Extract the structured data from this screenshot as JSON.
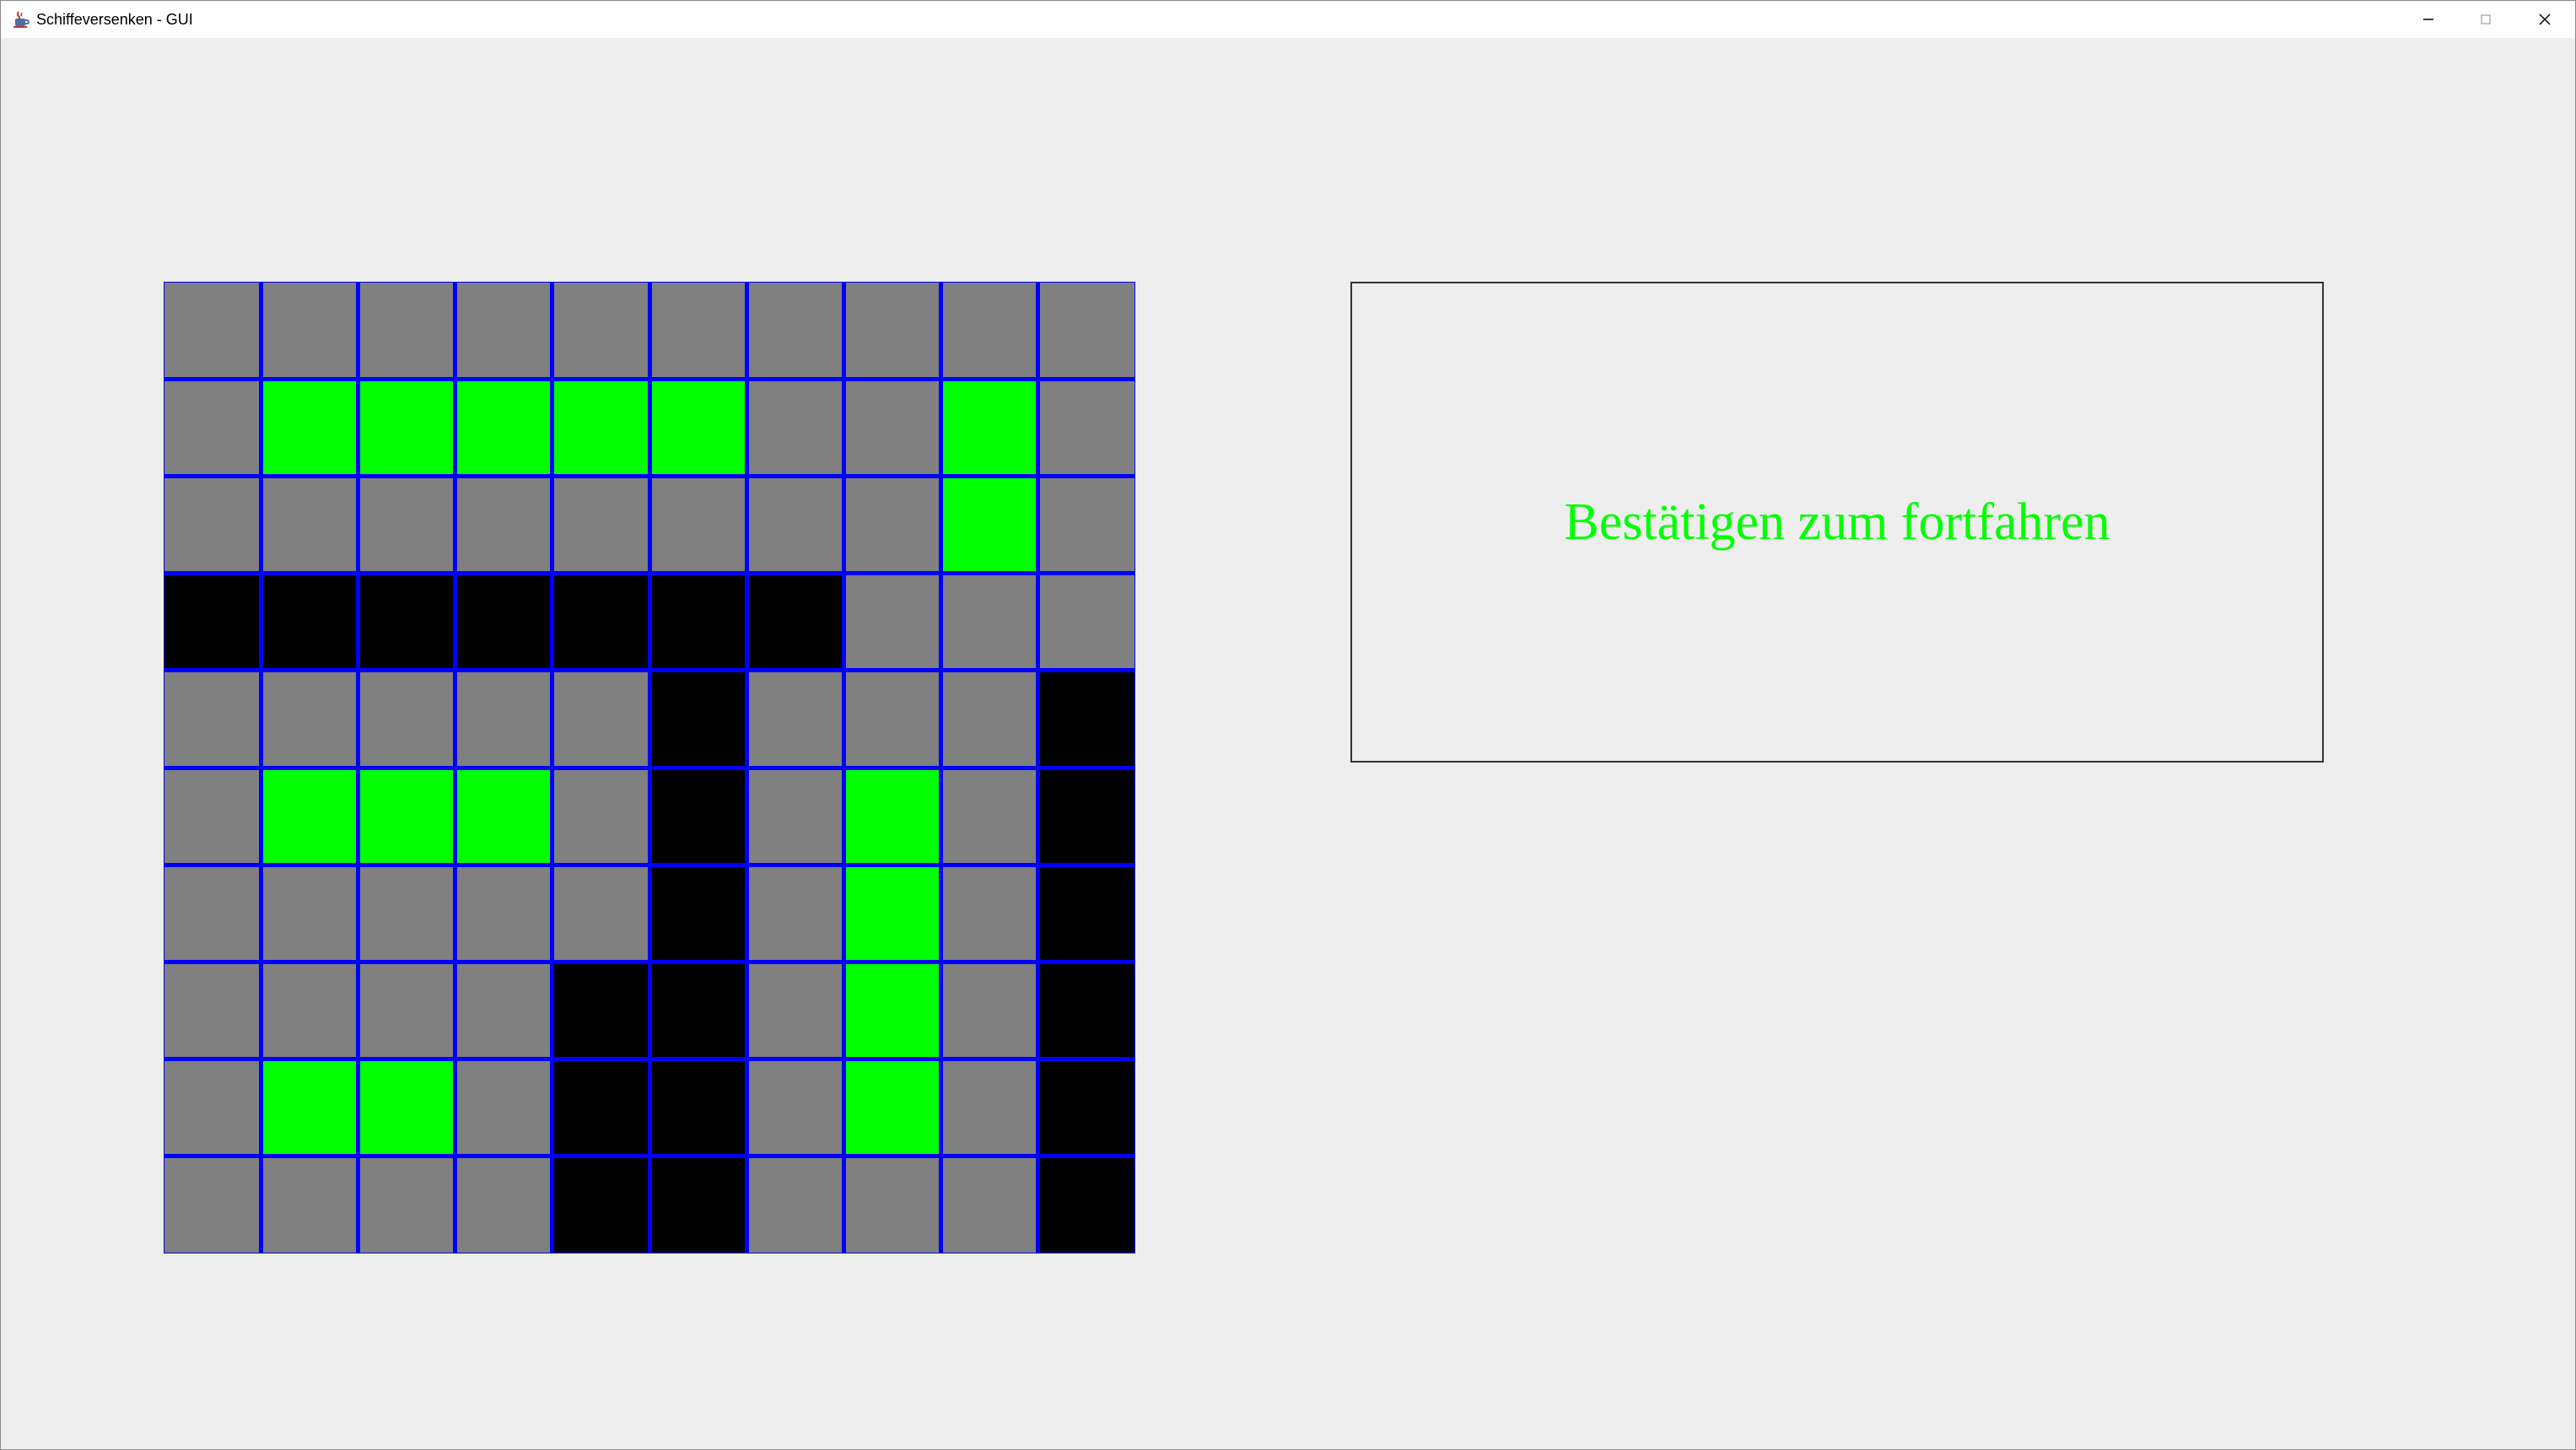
{
  "window": {
    "title": "Schiffeversenken - GUI",
    "app_icon": "java-cup-icon",
    "controls": {
      "minimize_icon": "minimize-icon",
      "maximize_icon": "maximize-icon",
      "close_icon": "close-icon"
    }
  },
  "board": {
    "rows": 10,
    "cols": 10,
    "grid_line_color": "#0000ff",
    "legend": {
      "W": "#808080",
      "S": "#00ff00",
      "X": "#000000"
    },
    "cells": [
      "WWWWWWWWWW",
      "WSSSSSWWSW",
      "WWWWWWWWSW",
      "XXXXXXXWWW",
      "WWWWWXWWWX",
      "WSSSWXWSWX",
      "WWWWWXWSWX",
      "WWWWXXWSWX",
      "WSSWXXWSWX",
      "WWWWXXWWWX"
    ]
  },
  "message": {
    "text": "Bestätigen zum fortfahren",
    "color": "#00ff00"
  }
}
